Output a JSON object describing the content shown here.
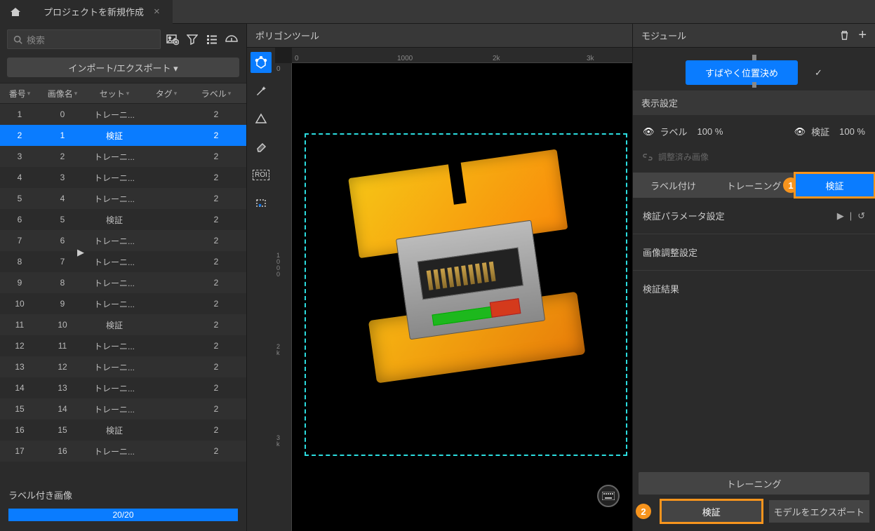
{
  "topbar": {
    "tab_title": "プロジェクトを新規作成"
  },
  "left": {
    "search_placeholder": "検索",
    "import_export": "インポート/エクスポート ▾",
    "columns": {
      "num": "番号",
      "img": "画像名",
      "set": "セット",
      "tag": "タグ",
      "lbl": "ラベル"
    },
    "rows": [
      {
        "n": "1",
        "img": "0",
        "set": "トレーニ...",
        "lbl": "2",
        "sel": false
      },
      {
        "n": "2",
        "img": "1",
        "set": "検証",
        "lbl": "2",
        "sel": true
      },
      {
        "n": "3",
        "img": "2",
        "set": "トレーニ...",
        "lbl": "2",
        "sel": false
      },
      {
        "n": "4",
        "img": "3",
        "set": "トレーニ...",
        "lbl": "2",
        "sel": false
      },
      {
        "n": "5",
        "img": "4",
        "set": "トレーニ...",
        "lbl": "2",
        "sel": false
      },
      {
        "n": "6",
        "img": "5",
        "set": "検証",
        "lbl": "2",
        "sel": false
      },
      {
        "n": "7",
        "img": "6",
        "set": "トレーニ...",
        "lbl": "2",
        "sel": false
      },
      {
        "n": "8",
        "img": "7",
        "set": "トレーニ...",
        "lbl": "2",
        "sel": false
      },
      {
        "n": "9",
        "img": "8",
        "set": "トレーニ...",
        "lbl": "2",
        "sel": false
      },
      {
        "n": "10",
        "img": "9",
        "set": "トレーニ...",
        "lbl": "2",
        "sel": false
      },
      {
        "n": "11",
        "img": "10",
        "set": "検証",
        "lbl": "2",
        "sel": false
      },
      {
        "n": "12",
        "img": "11",
        "set": "トレーニ...",
        "lbl": "2",
        "sel": false
      },
      {
        "n": "13",
        "img": "12",
        "set": "トレーニ...",
        "lbl": "2",
        "sel": false
      },
      {
        "n": "14",
        "img": "13",
        "set": "トレーニ...",
        "lbl": "2",
        "sel": false
      },
      {
        "n": "15",
        "img": "14",
        "set": "トレーニ...",
        "lbl": "2",
        "sel": false
      },
      {
        "n": "16",
        "img": "15",
        "set": "検証",
        "lbl": "2",
        "sel": false
      },
      {
        "n": "17",
        "img": "16",
        "set": "トレーニ...",
        "lbl": "2",
        "sel": false
      }
    ],
    "footer_label": "ラベル付き画像",
    "progress_text": "20/20"
  },
  "center": {
    "header": "ポリゴンツール",
    "ruler_x": [
      "0",
      "1000",
      "2k",
      "3k"
    ],
    "ruler_y": [
      "0",
      "1000",
      "2k",
      "3k"
    ],
    "roi_label": "ROI"
  },
  "right": {
    "header": "モジュール",
    "quick_btn": "すばやく位置決め",
    "display_section": "表示設定",
    "label_text": "ラベル",
    "label_pct": "100 %",
    "verify_text": "検証",
    "verify_pct": "100 %",
    "adjusted_text": "調整済み画像",
    "tab_label": "ラベル付け",
    "tab_train": "トレーニング",
    "tab_verify": "検証",
    "param_section": "検証パラメータ設定",
    "image_adjust": "画像調整設定",
    "result_section": "検証結果",
    "train_btn": "トレーニング",
    "verify_btn": "検証",
    "export_btn": "モデルをエクスポート",
    "badge1": "1",
    "badge2": "2"
  }
}
